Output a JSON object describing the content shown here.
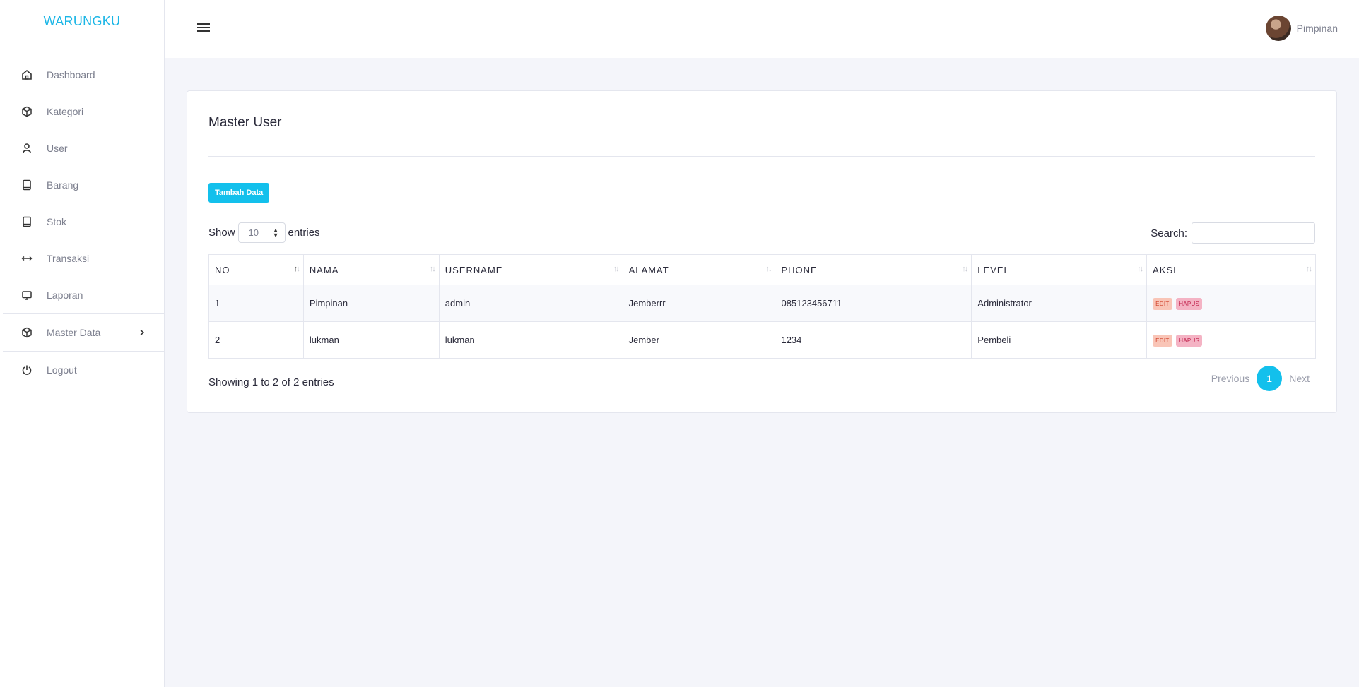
{
  "brand": "WARUNGKU",
  "sidebar": {
    "items": [
      {
        "label": "Dashboard",
        "icon": "home-icon"
      },
      {
        "label": "Kategori",
        "icon": "cube-icon"
      },
      {
        "label": "User",
        "icon": "user-icon"
      },
      {
        "label": "Barang",
        "icon": "book-icon"
      },
      {
        "label": "Stok",
        "icon": "book-icon"
      },
      {
        "label": "Transaksi",
        "icon": "arrows-horizontal-icon"
      },
      {
        "label": "Laporan",
        "icon": "monitor-icon"
      },
      {
        "label": "Master Data",
        "icon": "cube-icon"
      },
      {
        "label": "Logout",
        "icon": "power-icon"
      }
    ]
  },
  "topbar": {
    "user_name": "Pimpinan"
  },
  "card": {
    "title": "Master User",
    "add_button": "Tambah Data",
    "show_label": "Show",
    "entries_label": "entries",
    "length_value": "10",
    "search_label": "Search:",
    "info": "Showing 1 to 2 of 2 entries"
  },
  "table": {
    "headers": [
      "NO",
      "NAMA",
      "USERNAME",
      "ALAMAT",
      "PHONE",
      "LEVEL",
      "AKSI"
    ],
    "rows": [
      {
        "no": "1",
        "nama": "Pimpinan",
        "username": "admin",
        "alamat": "Jemberrr",
        "phone": "085123456711",
        "level": "Administrator",
        "edit": "EDIT",
        "hapus": "HAPUS"
      },
      {
        "no": "2",
        "nama": "lukman",
        "username": "lukman",
        "alamat": "Jember",
        "phone": "1234",
        "level": "Pembeli",
        "edit": "EDIT",
        "hapus": "HAPUS"
      }
    ]
  },
  "pagination": {
    "previous": "Previous",
    "current": "1",
    "next": "Next"
  },
  "colors": {
    "accent": "#13c0ec",
    "brand": "#1bb6e6"
  }
}
